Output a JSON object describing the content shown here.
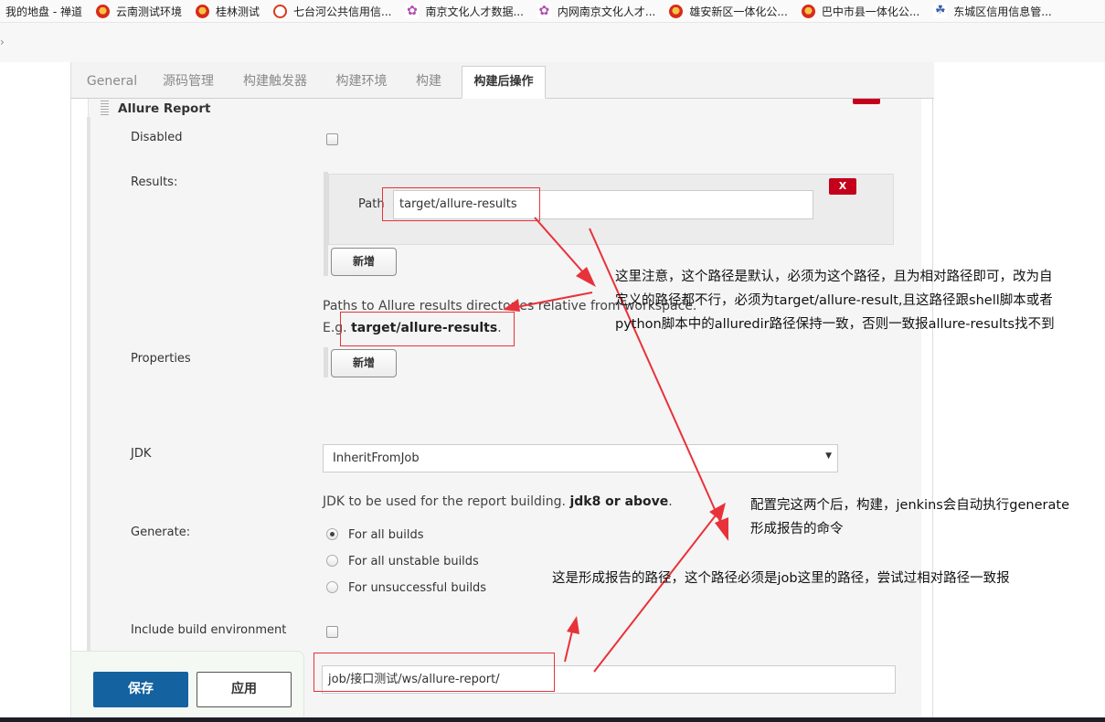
{
  "bookmarks": [
    {
      "label": "我的地盘 - 禅道",
      "icon": "none"
    },
    {
      "label": "云南测试环境",
      "icon": "emblem-icon"
    },
    {
      "label": "桂林测试",
      "icon": "emblem-icon"
    },
    {
      "label": "七台河公共信用信...",
      "icon": "ring-icon"
    },
    {
      "label": "南京文化人才数据...",
      "icon": "star-icon"
    },
    {
      "label": "内网南京文化人才...",
      "icon": "star-icon"
    },
    {
      "label": "雄安新区一体化公...",
      "icon": "emblem-icon"
    },
    {
      "label": "巴中市县一体化公...",
      "icon": "emblem-icon"
    },
    {
      "label": "东城区信用信息管...",
      "icon": "leaf-icon"
    }
  ],
  "tabs": [
    "General",
    "源码管理",
    "构建触发器",
    "构建环境",
    "构建",
    "构建后操作"
  ],
  "active_tab": 5,
  "allure": {
    "title": "Allure Report",
    "disabled_label": "Disabled",
    "results_label": "Results:",
    "path_label": "Path",
    "path_value": "target/allure-results",
    "delete_label": "X",
    "add_label": "新增",
    "results_help_text": "Paths to Allure results directories relative from workspace.",
    "results_help_eg": "E.g.",
    "results_help_example": "target/allure-results",
    "results_help_dot": ".",
    "properties_label": "Properties",
    "properties_add_label": "新增",
    "jdk_label": "JDK",
    "jdk_value": "InheritFromJob",
    "jdk_help_text": "JDK to be used for the report building.",
    "jdk_help_bold": "jdk8 or above",
    "jdk_help_dot": ".",
    "generate_label": "Generate:",
    "generate_options": [
      "For all builds",
      "For all unstable builds",
      "For unsuccessful builds"
    ],
    "generate_selected": 0,
    "include_env_label": "Include build environment",
    "report_path_value": "job/接口测试/ws/allure-report/"
  },
  "footer": {
    "save_label": "保存",
    "apply_label": "应用"
  },
  "annotations": {
    "note1_line1": "这里注意，这个路径是默认，必须为这个路径，且为相对路径即可，改为自",
    "note1_line2": "定义的路径都不行，必须为target/allure-result,且这路径跟shell脚本或者",
    "note1_line3": "python脚本中的alluredir路径保持一致，否则一致报allure-results找不到",
    "note2_line1": "配置完这两个后，构建，jenkins会自动执行generate",
    "note2_line2": "形成报告的命令",
    "note3": "这是形成报告的路径，这个路径必须是job这里的路径，尝试过相对路径一致报"
  },
  "colors": {
    "annotation_red": "#e8323a",
    "save_blue": "#1462a0",
    "delete_red": "#c4001c"
  }
}
